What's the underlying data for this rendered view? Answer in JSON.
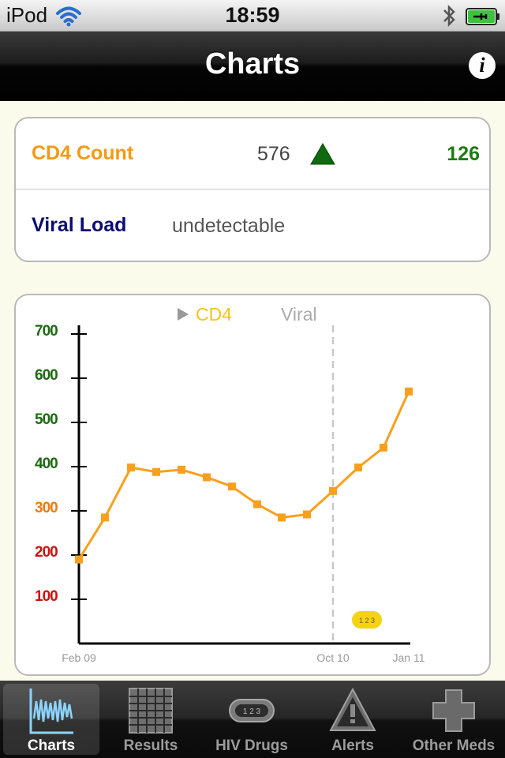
{
  "status_bar": {
    "device": "iPod",
    "time": "18:59",
    "icons": [
      "wifi-icon",
      "bluetooth-icon",
      "battery-charging-icon"
    ]
  },
  "nav": {
    "title": "Charts",
    "info_icon": "info-icon",
    "info_glyph": "i"
  },
  "summary": {
    "cd4": {
      "label": "CD4 Count",
      "value": "576",
      "trend_icon": "up-triangle-icon",
      "change": "126"
    },
    "viral": {
      "label": "Viral Load",
      "value": "undetectable"
    }
  },
  "chart": {
    "toggle": {
      "selected": "CD4",
      "other": "Viral"
    },
    "badge": "1 2 3",
    "colors": {
      "line": "#f8a01e",
      "high": "#1d6a12",
      "mid": "#f07a10",
      "low": "#d01010"
    }
  },
  "chart_data": {
    "type": "line",
    "x": [
      "Feb 09",
      "",
      "",
      "",
      "",
      "",
      "",
      "",
      "",
      "",
      "Oct 10",
      "",
      "",
      "Jan 11"
    ],
    "xticks": [
      "Feb 09",
      "Oct 10",
      "Jan 11"
    ],
    "yticks": [
      100,
      200,
      300,
      400,
      500,
      600,
      700
    ],
    "ylim": [
      0,
      700
    ],
    "series": [
      {
        "name": "CD4",
        "values": [
          190,
          285,
          398,
          388,
          393,
          376,
          355,
          315,
          285,
          292,
          345,
          398,
          443,
          570
        ]
      }
    ],
    "marker_line_at": "Oct 10",
    "grid": false
  },
  "tabs": [
    {
      "label": "Charts",
      "icon": "line-chart-icon",
      "active": true
    },
    {
      "label": "Results",
      "icon": "grid-table-icon",
      "active": false
    },
    {
      "label": "HIV Drugs",
      "icon": "pill-icon",
      "active": false
    },
    {
      "label": "Alerts",
      "icon": "warning-triangle-icon",
      "active": false
    },
    {
      "label": "Other Meds",
      "icon": "medical-cross-icon",
      "active": false
    }
  ]
}
